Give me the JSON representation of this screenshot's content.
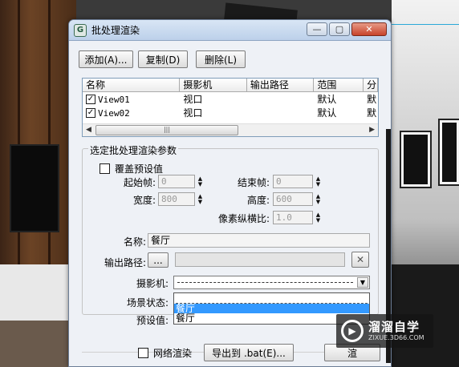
{
  "window": {
    "title": "批处理渲染",
    "app_icon_letter": "G",
    "min_glyph": "—",
    "max_glyph": "▢",
    "close_glyph": "✕"
  },
  "toolbar": {
    "add_label": "添加(A)...",
    "copy_label": "复制(D)",
    "delete_label": "删除(L)"
  },
  "list": {
    "columns": [
      "名称",
      "摄影机",
      "输出路径",
      "范围",
      "分"
    ],
    "rows": [
      {
        "checked": true,
        "check_glyph": "✓",
        "name": "View01",
        "camera": "视口",
        "output": "",
        "range": "默认",
        "extra": "默"
      },
      {
        "checked": true,
        "check_glyph": "✓",
        "name": "View02",
        "camera": "视口",
        "output": "",
        "range": "默认",
        "extra": "默"
      }
    ],
    "scroll_left": "◀",
    "scroll_right": "▶",
    "scroll_thumb_grip": "|||"
  },
  "params": {
    "group_title": "选定批处理渲染参数",
    "override_preset_label": "覆盖预设值",
    "override_checked": false,
    "start_frame_label": "起始帧:",
    "start_frame_value": "0",
    "end_frame_label": "结束帧:",
    "end_frame_value": "0",
    "width_label": "宽度:",
    "width_value": "800",
    "height_label": "高度:",
    "height_value": "600",
    "pixel_aspect_label": "像素纵横比:",
    "pixel_aspect_value": "1.0",
    "name_label": "名称:",
    "name_value": "餐厅",
    "output_path_label": "输出路径:",
    "browse_label": "...",
    "output_path_value": "",
    "clear_glyph": "✕",
    "camera_label": "摄影机:",
    "scene_state_label": "场景状态:",
    "preset_label": "预设值:",
    "dropdown_glyph": "▼",
    "dropdown_options": [
      "餐厅",
      "餐厅"
    ],
    "selected_option_index": 0
  },
  "bottom": {
    "net_render_label": "网络渲染",
    "net_render_checked": false,
    "export_bat_label": "导出到 .bat(E)...",
    "render_label": "渲"
  },
  "watermark": {
    "brand": "溜溜自学",
    "url": "ZIXUE.3D66.COM",
    "logo_glyph": "▶"
  },
  "colors": {
    "selection_blue": "#3399ff",
    "close_red": "#c8432b",
    "title_blue": "#bcd0ea",
    "dialog_bg": "#eef1f6"
  }
}
